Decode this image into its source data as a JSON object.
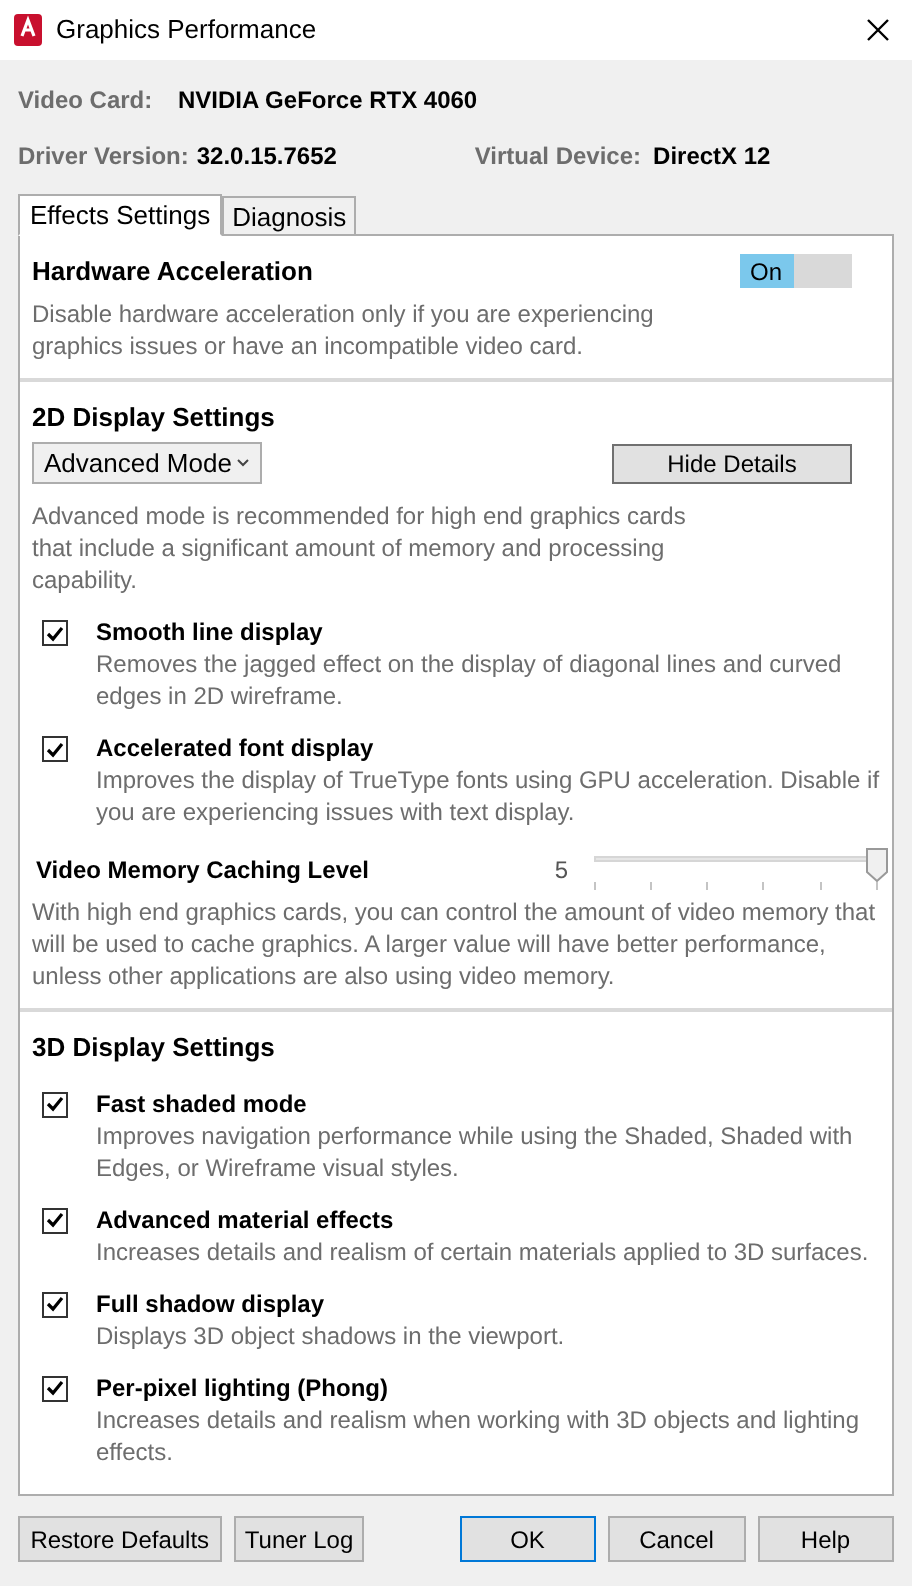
{
  "window": {
    "title": "Graphics Performance"
  },
  "info": {
    "video_card": {
      "label": "Video Card:",
      "value": "NVIDIA GeForce RTX 4060"
    },
    "driver_version": {
      "label": "Driver Version:",
      "value": "32.0.15.7652"
    },
    "virtual_device": {
      "label": "Virtual Device:",
      "value": "DirectX 12"
    }
  },
  "tabs": [
    {
      "label": "Effects Settings",
      "selected": true
    },
    {
      "label": "Diagnosis",
      "selected": false
    }
  ],
  "hardware_acceleration": {
    "title": "Hardware Acceleration",
    "description": "Disable hardware acceleration only if you are experiencing graphics issues or have an incompatible video card.",
    "toggle": {
      "label": "On",
      "on": true
    }
  },
  "display_2d": {
    "title": "2D Display Settings",
    "mode_dropdown": {
      "value": "Advanced Mode"
    },
    "hide_details_button": "Hide Details",
    "description": "Advanced mode is recommended for high end graphics cards that include a significant amount of memory and processing capability.",
    "options": [
      {
        "label": "Smooth line display",
        "description": "Removes the jagged effect on the display of diagonal lines and curved edges in 2D wireframe.",
        "checked": true
      },
      {
        "label": "Accelerated font display",
        "description": "Improves the display of TrueType fonts using GPU acceleration. Disable if you are experiencing issues with text display.",
        "checked": true
      }
    ],
    "caching": {
      "label": "Video Memory Caching Level",
      "reading": "5",
      "level": 1,
      "description": "With high end graphics cards, you can control the amount of video memory that will be used to cache graphics.  A larger value will have better performance, unless other applications are also using video memory."
    }
  },
  "display_3d": {
    "title": "3D Display Settings",
    "options": [
      {
        "label": "Fast shaded mode",
        "description": "Improves navigation performance while using the Shaded, Shaded with Edges, or Wireframe visual styles.",
        "checked": true
      },
      {
        "label": "Advanced material effects",
        "description": "Increases details and realism of certain materials applied to 3D surfaces.",
        "checked": true
      },
      {
        "label": "Full shadow display",
        "description": "Displays 3D object shadows in the viewport.",
        "checked": true
      },
      {
        "label": "Per-pixel lighting (Phong)",
        "description": "Increases details and realism when working with 3D objects and lighting effects.",
        "checked": true
      }
    ]
  },
  "buttons_left": [
    {
      "label": "Restore Defaults",
      "focused": false
    },
    {
      "label": "Tuner Log",
      "focused": false
    }
  ],
  "buttons_right": [
    {
      "label": "OK",
      "focused": true
    },
    {
      "label": "Cancel",
      "focused": false
    },
    {
      "label": "Help",
      "focused": false
    }
  ]
}
